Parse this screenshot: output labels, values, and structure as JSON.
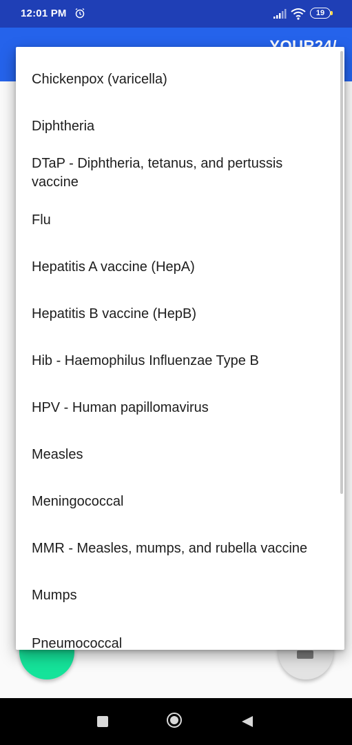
{
  "status_bar": {
    "time": "12:01 PM",
    "battery": "19",
    "icons": [
      "alarm-icon",
      "signal-icon",
      "wifi-icon",
      "battery-icon"
    ]
  },
  "app_bar": {
    "title": "YOUR24/"
  },
  "dialog": {
    "items": [
      {
        "label": "Chickenpox (varicella)"
      },
      {
        "label": "Diphtheria"
      },
      {
        "label": "DTaP - Diphtheria, tetanus, and pertussis vaccine"
      },
      {
        "label": "Flu"
      },
      {
        "label": "Hepatitis A vaccine (HepA)"
      },
      {
        "label": "Hepatitis B vaccine (HepB)"
      },
      {
        "label": "Hib - Haemophilus Influenzae Type B"
      },
      {
        "label": "HPV - Human papillomavirus"
      },
      {
        "label": "Measles"
      },
      {
        "label": "Meningococcal"
      },
      {
        "label": "MMR - Measles, mumps, and rubella vaccine"
      },
      {
        "label": "Mumps"
      },
      {
        "label": "Pneumococcal"
      }
    ]
  },
  "colors": {
    "status_bar": "#1f3fb6",
    "app_bar": "#2563eb",
    "fab_green": "#15e39a",
    "fab_grey": "#e3e3e3"
  },
  "nav_bar": {
    "icons": [
      "recents-icon",
      "home-icon",
      "back-icon"
    ]
  }
}
